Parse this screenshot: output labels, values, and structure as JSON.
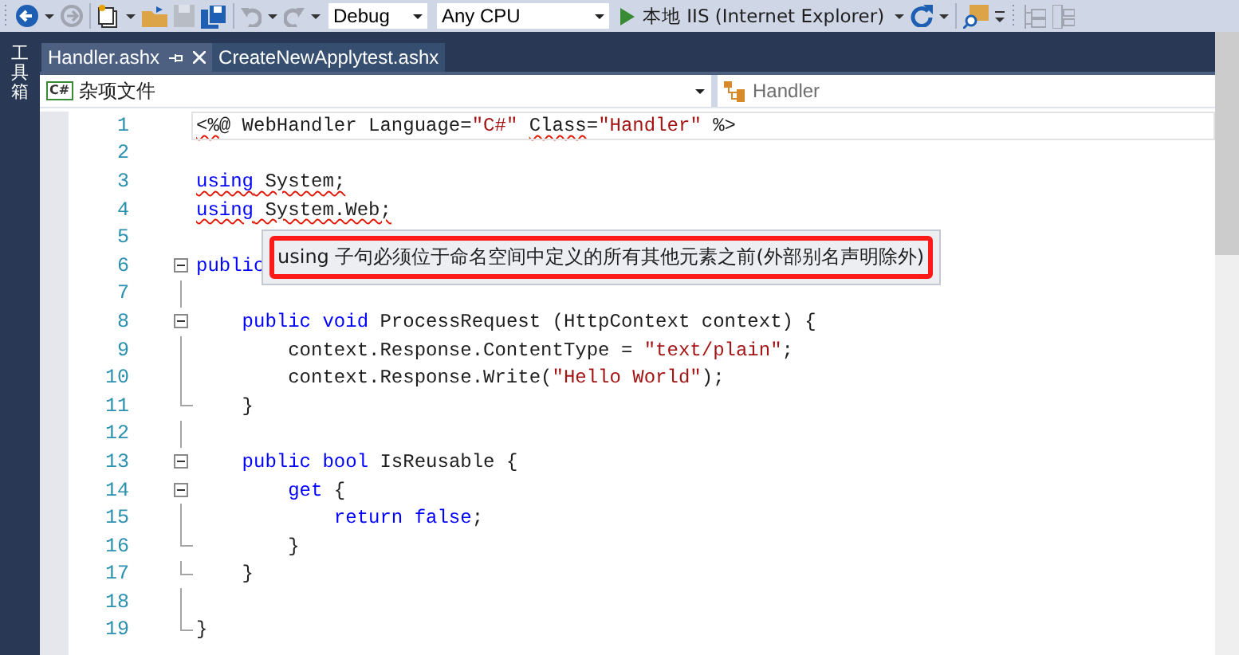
{
  "toolbar": {
    "configuration": "Debug",
    "platform": "Any CPU",
    "run_target": "本地 IIS (Internet Explorer)"
  },
  "toolbox": {
    "label": "工具箱"
  },
  "tabs": [
    {
      "label": "Handler.ashx",
      "selected": true
    },
    {
      "label": "CreateNewApplytest.ashx",
      "selected": false
    }
  ],
  "navbar": {
    "project": "杂项文件",
    "project_badge": "C#",
    "member": "Handler"
  },
  "code_lines": [
    {
      "number": "1",
      "collapsible": false,
      "fold_end": false,
      "current": true,
      "segments": [
        {
          "text": "<%",
          "kind": "text",
          "squiggle": true
        },
        {
          "text": "@ WebHandler Language=",
          "kind": "text",
          "squiggle": false
        },
        {
          "text": "\"C#\" ",
          "kind": "str",
          "squiggle": false
        },
        {
          "text": "Class",
          "kind": "text",
          "squiggle": true
        },
        {
          "text": "=",
          "kind": "text",
          "squiggle": false
        },
        {
          "text": "\"Handler\"",
          "kind": "str",
          "squiggle": false
        },
        {
          "text": " %>",
          "kind": "text",
          "squiggle": false
        }
      ]
    },
    {
      "number": "2",
      "collapsible": false,
      "fold_end": false,
      "current": false
    },
    {
      "number": "3",
      "collapsible": false,
      "fold_end": false,
      "current": false,
      "segments": [
        {
          "text": "using",
          "kind": "kw",
          "squiggle": true
        },
        {
          "text": " System;",
          "kind": "text",
          "squiggle": true
        }
      ]
    },
    {
      "number": "4",
      "collapsible": false,
      "fold_end": false,
      "current": false,
      "segments": [
        {
          "text": "using",
          "kind": "kw",
          "squiggle": true
        },
        {
          "text": " System.Web;",
          "kind": "text",
          "squiggle": true
        }
      ]
    },
    {
      "number": "5",
      "collapsible": false,
      "fold_end": false,
      "current": false
    },
    {
      "number": "6",
      "collapsible": true,
      "fold_end": false,
      "current": false,
      "segments": [
        {
          "text": "public",
          "kind": "kw",
          "squiggle": false
        }
      ]
    },
    {
      "number": "7",
      "collapsible": false,
      "fold_end": false,
      "current": false
    },
    {
      "number": "8",
      "collapsible": true,
      "fold_end": false,
      "current": false,
      "segments": [
        {
          "text": "    public void",
          "kind": "kw",
          "squiggle": false
        },
        {
          "text": " ProcessRequest (HttpContext context) {",
          "kind": "text",
          "squiggle": false
        }
      ]
    },
    {
      "number": "9",
      "collapsible": false,
      "fold_end": false,
      "current": false,
      "segments": [
        {
          "text": "        context.Response.ContentType = ",
          "kind": "text",
          "squiggle": false
        },
        {
          "text": "\"text/plain\"",
          "kind": "str",
          "squiggle": false
        },
        {
          "text": ";",
          "kind": "text",
          "squiggle": false
        }
      ]
    },
    {
      "number": "10",
      "collapsible": false,
      "fold_end": false,
      "current": false,
      "segments": [
        {
          "text": "        context.Response.Write(",
          "kind": "text",
          "squiggle": false
        },
        {
          "text": "\"Hello World\"",
          "kind": "str",
          "squiggle": false
        },
        {
          "text": ");",
          "kind": "text",
          "squiggle": false
        }
      ]
    },
    {
      "number": "11",
      "collapsible": false,
      "fold_end": true,
      "current": false,
      "segments": [
        {
          "text": "    }",
          "kind": "text",
          "squiggle": false
        }
      ]
    },
    {
      "number": "12",
      "collapsible": false,
      "fold_end": false,
      "current": false
    },
    {
      "number": "13",
      "collapsible": true,
      "fold_end": false,
      "current": false,
      "segments": [
        {
          "text": "    public bool",
          "kind": "kw",
          "squiggle": false
        },
        {
          "text": " IsReusable {",
          "kind": "text",
          "squiggle": false
        }
      ]
    },
    {
      "number": "14",
      "collapsible": true,
      "fold_end": false,
      "current": false,
      "segments": [
        {
          "text": "        get",
          "kind": "kw",
          "squiggle": false
        },
        {
          "text": " {",
          "kind": "text",
          "squiggle": false
        }
      ]
    },
    {
      "number": "15",
      "collapsible": false,
      "fold_end": false,
      "current": false,
      "segments": [
        {
          "text": "            return false",
          "kind": "kw",
          "squiggle": false
        },
        {
          "text": ";",
          "kind": "text",
          "squiggle": false
        }
      ]
    },
    {
      "number": "16",
      "collapsible": false,
      "fold_end": true,
      "current": false,
      "segments": [
        {
          "text": "        }",
          "kind": "text",
          "squiggle": false
        }
      ]
    },
    {
      "number": "17",
      "collapsible": false,
      "fold_end": true,
      "current": false,
      "segments": [
        {
          "text": "    }",
          "kind": "text",
          "squiggle": false
        }
      ]
    },
    {
      "number": "18",
      "collapsible": false,
      "fold_end": false,
      "current": false
    },
    {
      "number": "19",
      "collapsible": false,
      "fold_end": true,
      "current": false,
      "segments": [
        {
          "text": "}",
          "kind": "text",
          "squiggle": false
        }
      ]
    }
  ],
  "tooltip": {
    "text": "using 子句必须位于命名空间中定义的所有其他元素之前(外部别名声明除外)",
    "highlighted": true
  }
}
